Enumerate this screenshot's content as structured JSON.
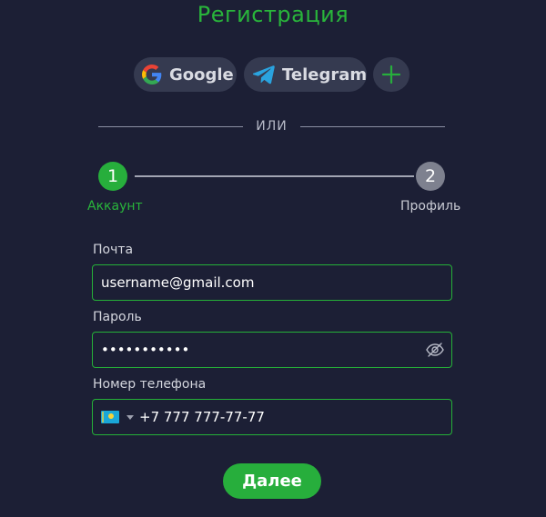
{
  "page": {
    "title": "Регистрация"
  },
  "social": {
    "google_label": "Google",
    "telegram_label": "Telegram",
    "more_icon": "plus-icon"
  },
  "divider": {
    "text": "ИЛИ"
  },
  "steps": [
    {
      "number": "1",
      "label": "Аккаунт",
      "state": "active",
      "color": "#27ae3c"
    },
    {
      "number": "2",
      "label": "Профиль",
      "state": "inactive",
      "color": "#7e818f"
    }
  ],
  "form": {
    "email": {
      "label": "Почта",
      "value": "username@gmail.com"
    },
    "password": {
      "label": "Пароль",
      "value": "•••••••••••",
      "toggle_icon": "eye-slash-icon"
    },
    "phone": {
      "label": "Номер телефона",
      "country_flag": "kazakhstan-flag-icon",
      "value": "+7 777 777-77-77"
    }
  },
  "submit": {
    "label": "Далее"
  },
  "colors": {
    "accent": "#27ae3c",
    "background": "#1c1f35",
    "button_bg": "#353a50"
  }
}
